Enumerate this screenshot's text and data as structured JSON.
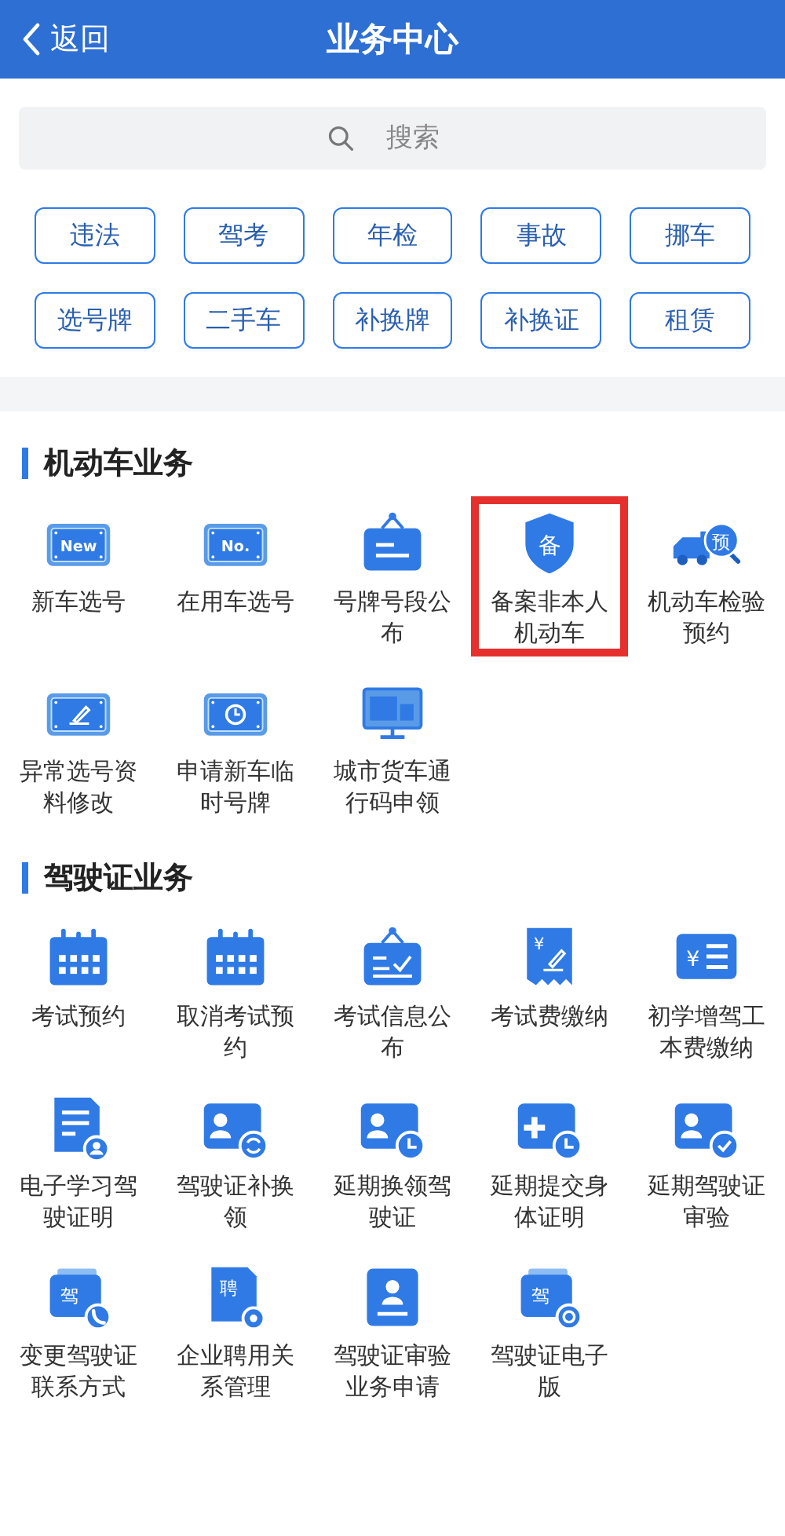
{
  "header": {
    "back_label": "返回",
    "title": "业务中心"
  },
  "search": {
    "placeholder": "搜索"
  },
  "tags": [
    "违法",
    "驾考",
    "年检",
    "事故",
    "挪车",
    "选号牌",
    "二手车",
    "补换牌",
    "补换证",
    "租赁"
  ],
  "sections": [
    {
      "title": "机动车业务",
      "items": [
        {
          "label": "新车选号",
          "kind": "plate",
          "badge": "New",
          "highlighted": false
        },
        {
          "label": "在用车选号",
          "kind": "plate",
          "badge": "No.",
          "highlighted": false
        },
        {
          "label": "号牌号段公布",
          "kind": "sign",
          "highlighted": false
        },
        {
          "label": "备案非本人机动车",
          "kind": "shield",
          "badge": "备",
          "highlighted": true
        },
        {
          "label": "机动车检验预约",
          "kind": "truck",
          "badge": "预",
          "highlighted": false
        },
        {
          "label": "异常选号资料修改",
          "kind": "plate-pen",
          "highlighted": false
        },
        {
          "label": "申请新车临时号牌",
          "kind": "plate-clock",
          "highlighted": false
        },
        {
          "label": "城市货车通行码申领",
          "kind": "screen",
          "highlighted": false
        }
      ]
    },
    {
      "title": "驾驶证业务",
      "items": [
        {
          "label": "考试预约",
          "kind": "calendar",
          "highlighted": false
        },
        {
          "label": "取消考试预约",
          "kind": "calendar",
          "highlighted": false
        },
        {
          "label": "考试信息公布",
          "kind": "sign-check",
          "highlighted": false
        },
        {
          "label": "考试费缴纳",
          "kind": "receipt",
          "badge": "¥",
          "highlighted": false
        },
        {
          "label": "初学增驾工本费缴纳",
          "kind": "card-list",
          "badge": "¥",
          "highlighted": false
        },
        {
          "label": "电子学习驾驶证明",
          "kind": "doc-person",
          "highlighted": false
        },
        {
          "label": "驾驶证补换领",
          "kind": "id-refresh",
          "highlighted": false
        },
        {
          "label": "延期换领驾驶证",
          "kind": "id-clock",
          "highlighted": false
        },
        {
          "label": "延期提交身体证明",
          "kind": "plus-clock",
          "highlighted": false
        },
        {
          "label": "延期驾驶证审验",
          "kind": "id-check",
          "highlighted": false
        },
        {
          "label": "变更驾驶证联系方式",
          "kind": "card-phone",
          "badge": "驾",
          "highlighted": false
        },
        {
          "label": "企业聘用关系管理",
          "kind": "doc-gear",
          "badge": "聘",
          "highlighted": false
        },
        {
          "label": "驾驶证审验业务申请",
          "kind": "stamp",
          "highlighted": false
        },
        {
          "label": "驾驶证电子版",
          "kind": "card-e",
          "badge": "驾",
          "highlighted": false
        }
      ]
    }
  ]
}
